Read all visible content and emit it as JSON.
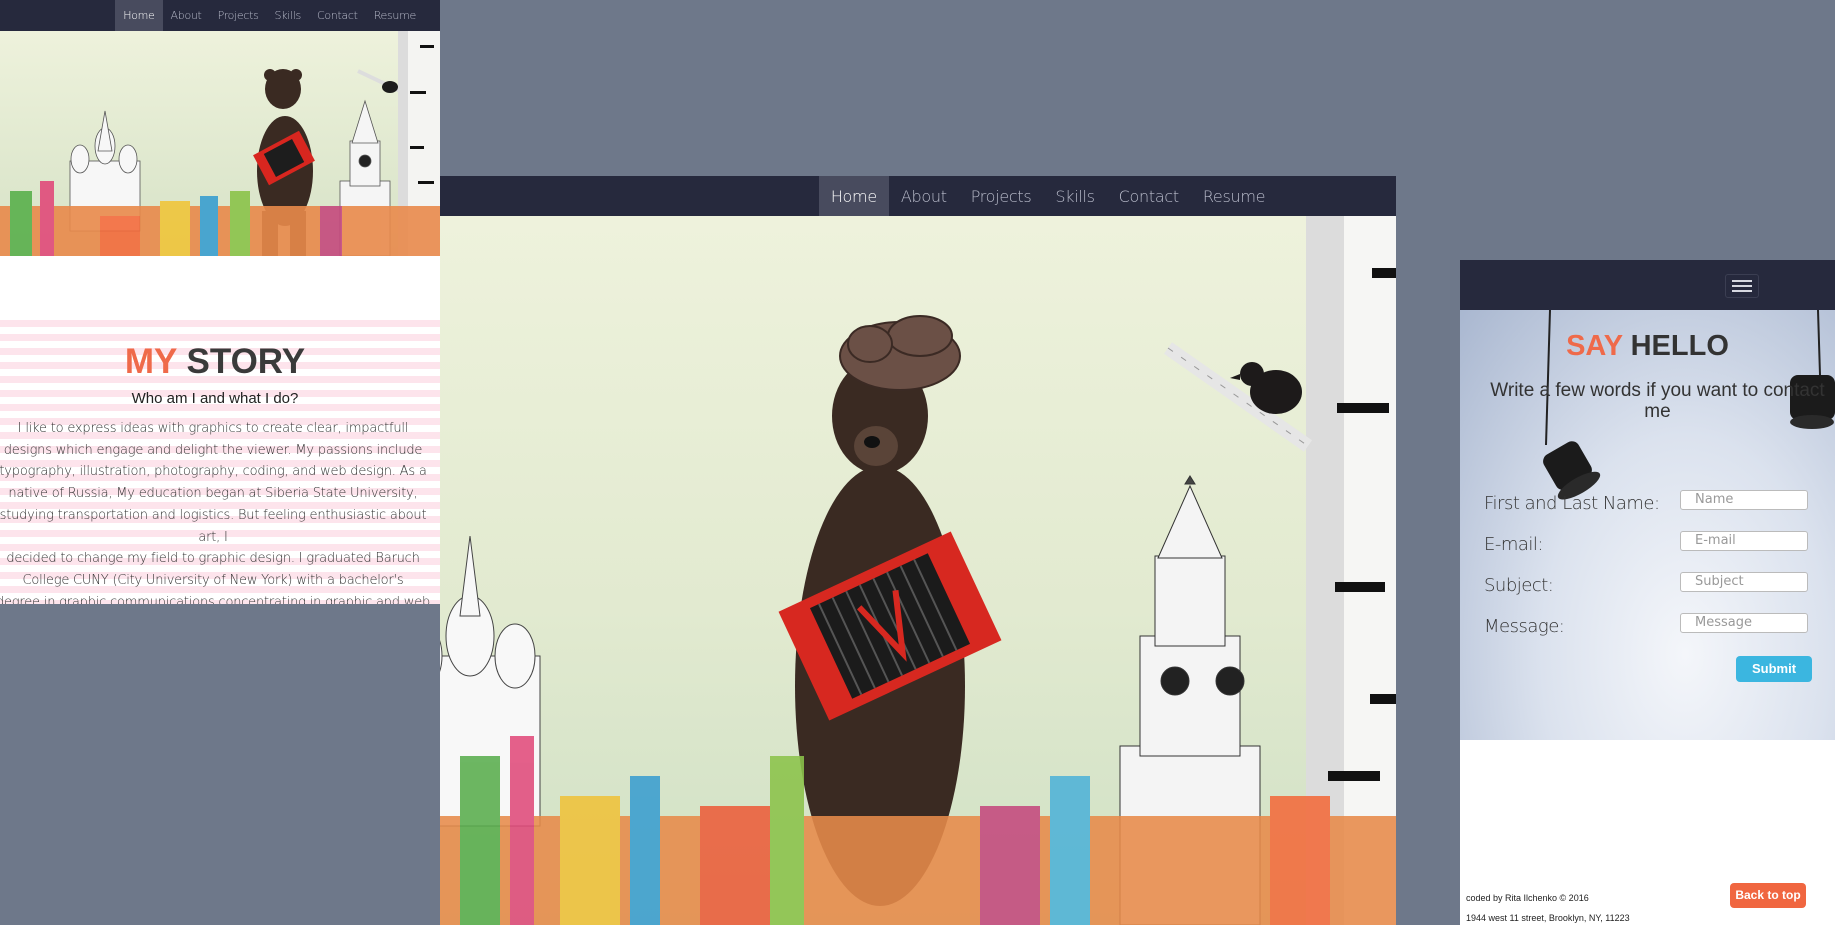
{
  "nav": {
    "items": [
      "Home",
      "About",
      "Projects",
      "Skills",
      "Contact",
      "Resume"
    ],
    "active": "Home"
  },
  "story": {
    "title_accent": "MY",
    "title_rest": "STORY",
    "subtitle": "Who am I and what I do?",
    "lines": [
      "I like to express ideas with graphics to create clear, impactfull",
      "designs which engage and delight the viewer. My passions include",
      "typography, illustration, photography, coding, and web design. As a",
      "native of Russia, My education began at Siberia State University,",
      "studying transportation and logistics. But feeling enthusiastic about art, I",
      "decided to change my field to graphic design. I graduated Baruch",
      "College CUNY (City University of New York) with a bachelor's",
      "degree in graphic communications concentrating in graphic and web"
    ]
  },
  "contact": {
    "title_accent": "SAY",
    "title_rest": "HELLO",
    "subtitle": "Write a few words if you want to contact me",
    "fields": [
      {
        "label": "First and Last Name:",
        "placeholder": "Name"
      },
      {
        "label": "E-mail:",
        "placeholder": "E-mail"
      },
      {
        "label": "Subject:",
        "placeholder": "Subject"
      },
      {
        "label": "Message:",
        "placeholder": "Message"
      }
    ],
    "submit_label": "Submit"
  },
  "footer": {
    "credit": "coded by Rita Ilchenko © 2016",
    "address": "1944 west 11 street, Brooklyn, NY, 11223",
    "back_to_top": "Back to top"
  },
  "colors": {
    "accent": "#ef6a4a",
    "nav_bg": "#26293d",
    "submit": "#3bb6e0",
    "backdrop": "#6e788a"
  }
}
